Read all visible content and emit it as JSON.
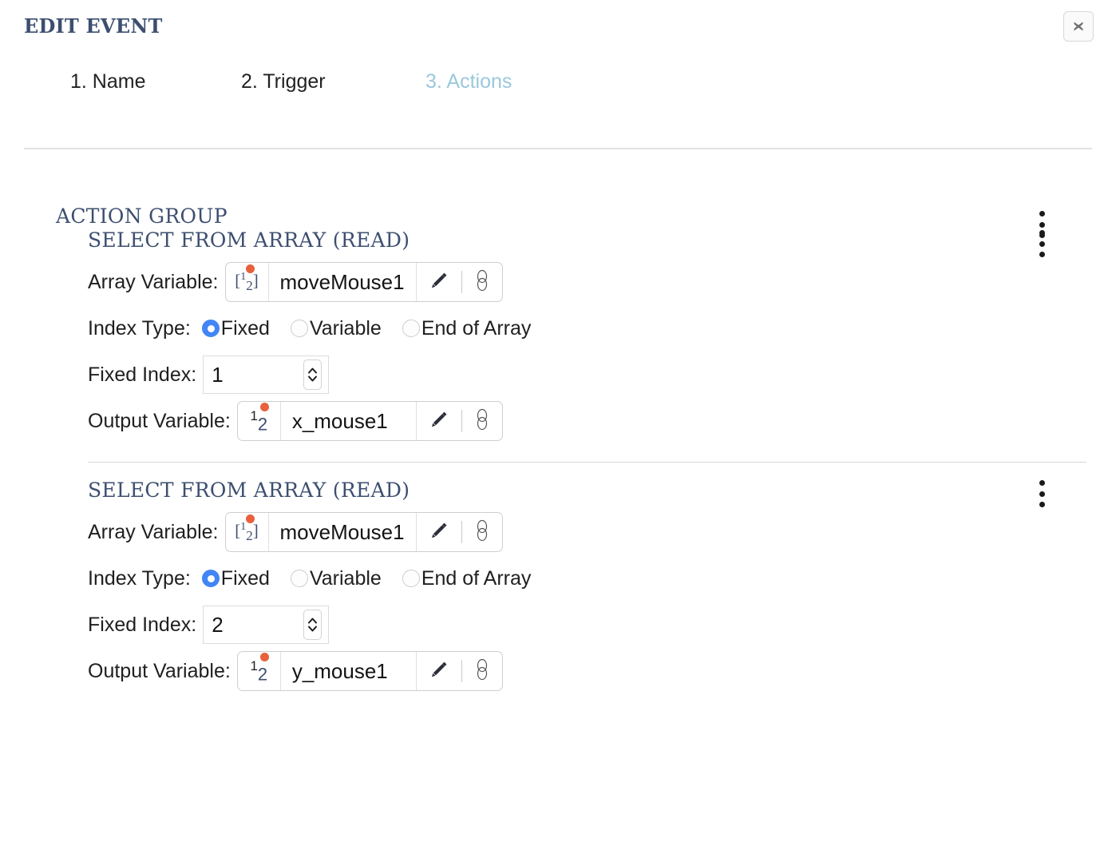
{
  "dialog": {
    "title": "EDIT EVENT",
    "close_icon": "close-icon"
  },
  "tabs": [
    {
      "label": "1. Name",
      "active": false
    },
    {
      "label": "2. Trigger",
      "active": false
    },
    {
      "label": "3. Actions",
      "active": true
    }
  ],
  "colors": {
    "heading": "#3d4f70",
    "active_tab": "#9ac8dd",
    "radio_selected": "#4286f5",
    "type_icon_dot": "#e8603c",
    "divider": "#d8d8d8"
  },
  "action_group": {
    "title": "ACTION GROUP",
    "menu_icon": "kebab-menu-icon"
  },
  "actions": [
    {
      "title": "SELECT FROM ARRAY (READ)",
      "menu_icon": "kebab-menu-icon",
      "array_variable": {
        "label": "Array Variable:",
        "type_icon": "array-variable-icon",
        "value": "moveMouse1",
        "edit_icon": "pencil-icon",
        "link_icon": "link-icon"
      },
      "index_type": {
        "label": "Index Type:",
        "options": [
          {
            "label": "Fixed",
            "selected": true
          },
          {
            "label": "Variable",
            "selected": false
          },
          {
            "label": "End of Array",
            "selected": false
          }
        ]
      },
      "fixed_index": {
        "label": "Fixed Index:",
        "value": "1"
      },
      "output_variable": {
        "label": "Output Variable:",
        "type_icon": "number-variable-icon",
        "value": "x_mouse1",
        "edit_icon": "pencil-icon",
        "link_icon": "link-icon"
      }
    },
    {
      "title": "SELECT FROM ARRAY (READ)",
      "menu_icon": "kebab-menu-icon",
      "array_variable": {
        "label": "Array Variable:",
        "type_icon": "array-variable-icon",
        "value": "moveMouse1",
        "edit_icon": "pencil-icon",
        "link_icon": "link-icon"
      },
      "index_type": {
        "label": "Index Type:",
        "options": [
          {
            "label": "Fixed",
            "selected": true
          },
          {
            "label": "Variable",
            "selected": false
          },
          {
            "label": "End of Array",
            "selected": false
          }
        ]
      },
      "fixed_index": {
        "label": "Fixed Index:",
        "value": "2"
      },
      "output_variable": {
        "label": "Output Variable:",
        "type_icon": "number-variable-icon",
        "value": "y_mouse1",
        "edit_icon": "pencil-icon",
        "link_icon": "link-icon"
      }
    }
  ]
}
